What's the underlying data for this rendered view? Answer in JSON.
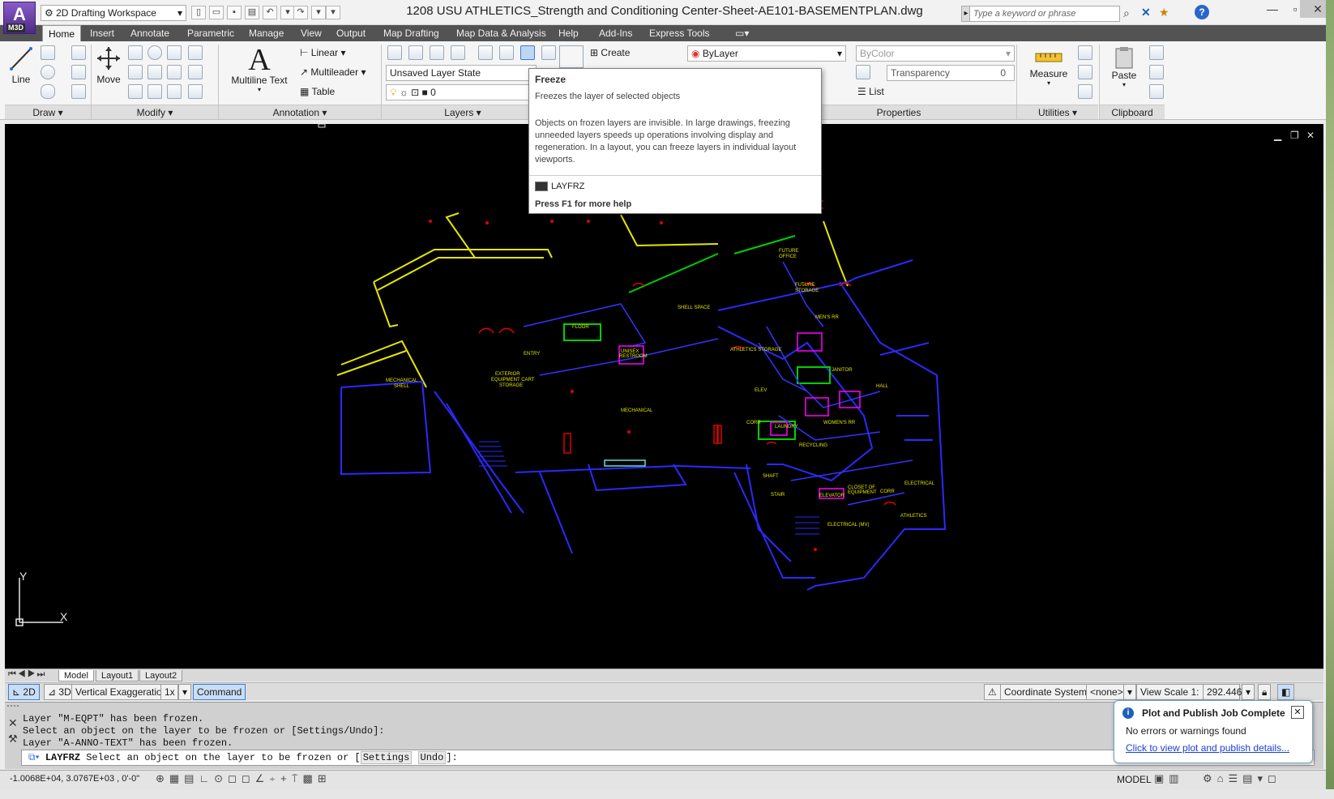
{
  "app": {
    "logo_text": "A",
    "logo_sub": "M3D",
    "workspace": "2D Drafting Workspace",
    "doc_title": "1208 USU ATHLETICS_Strength and Conditioning Center-Sheet-AE101-BASEMENTPLAN.dwg",
    "search_placeholder": "Type a keyword or phrase"
  },
  "ribbon_tabs": [
    "Home",
    "Insert",
    "Annotate",
    "Parametric",
    "Manage",
    "View",
    "Output",
    "Map Drafting",
    "Map Data & Analysis",
    "Help",
    "Add-Ins",
    "Express Tools"
  ],
  "panels": {
    "draw": "Draw",
    "modify": "Modify",
    "annotation": "Annotation",
    "layers": "Layers",
    "properties": "Properties",
    "utilities": "Utilities",
    "clipboard": "Clipboard"
  },
  "tools": {
    "line": "Line",
    "move": "Move",
    "mtext": "Multiline Text",
    "linear": "Linear",
    "multileader": "Multileader",
    "table": "Table",
    "layer_state": "Unsaved Layer State",
    "layer_current": "0",
    "create": "Create",
    "bylayer": "ByLayer",
    "bycolor": "ByColor",
    "transparency": "Transparency",
    "transparency_val": "0",
    "list": "List",
    "measure": "Measure",
    "paste": "Paste"
  },
  "tooltip": {
    "title": "Freeze",
    "subtitle": "Freezes the layer of selected objects",
    "description": "Objects on frozen layers are invisible. In large drawings, freezing unneeded layers speeds up operations involving display and regeneration. In a layout, you can freeze layers in individual layout viewports.",
    "command": "LAYFRZ",
    "help": "Press F1 for more help"
  },
  "layout_tabs": [
    "Model",
    "Layout1",
    "Layout2"
  ],
  "status_top": {
    "mode_2d": "2D",
    "mode_3d": "3D",
    "vert_exag": "Vertical Exaggeration:",
    "vert_exag_val": "1x",
    "command_btn": "Command",
    "coord_sys": "Coordinate System:",
    "coord_sys_val": "<none>",
    "view_scale": "View Scale  1:",
    "view_scale_val": "292.446"
  },
  "command_history": [
    "Layer \"M-EQPT\" has been frozen.",
    "Select an object on the layer to be frozen or [Settings/Undo]:",
    "Layer \"A-ANNO-TEXT\" has been frozen."
  ],
  "command_prompt": {
    "cmd": "LAYFRZ",
    "text": "Select an object on the layer to be frozen or [",
    "opt1": "Settings",
    "opt2": "Undo",
    "end": "]:"
  },
  "status_bottom": {
    "coords": "-1.0068E+04, 3.0767E+03 , 0'-0\"",
    "model": "MODEL"
  },
  "notification": {
    "title": "Plot and Publish Job Complete",
    "body": "No errors or warnings found",
    "link": "Click to view plot and publish details..."
  },
  "ucs": {
    "x": "X",
    "y": "Y"
  },
  "colors": {
    "yellow": "#e6e600",
    "blue": "#2a2aff",
    "red": "#e00000",
    "magenta": "#ff00ff",
    "green": "#00d000"
  }
}
